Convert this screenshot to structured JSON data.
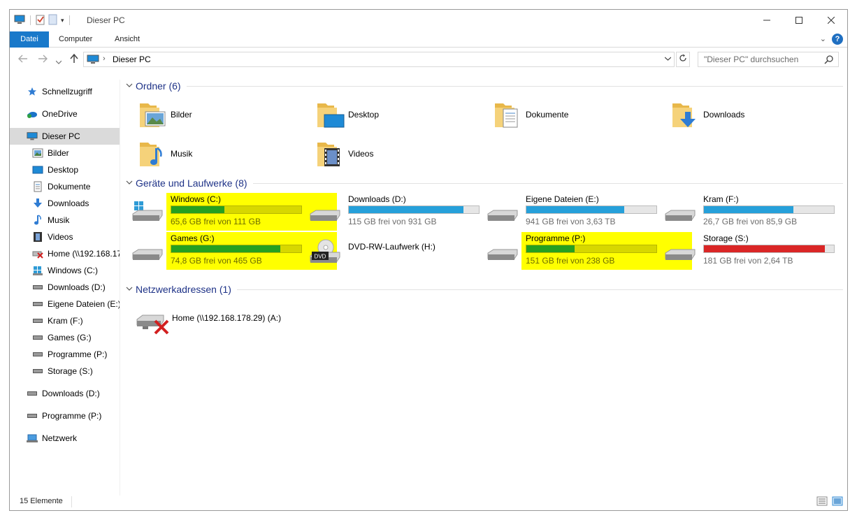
{
  "window": {
    "title": "Dieser PC"
  },
  "ribbon": {
    "tabs": [
      {
        "label": "Datei",
        "active": true
      },
      {
        "label": "Computer",
        "active": false
      },
      {
        "label": "Ansicht",
        "active": false
      }
    ],
    "help_label": "?"
  },
  "address": {
    "path": "Dieser PC",
    "search_placeholder": "\"Dieser PC\" durchsuchen"
  },
  "sidebar": {
    "items": [
      {
        "label": "Schnellzugriff",
        "icon": "star-icon"
      },
      {
        "label": "OneDrive",
        "icon": "onedrive-icon"
      },
      {
        "label": "Dieser PC",
        "icon": "computer-icon",
        "selected": true
      },
      {
        "label": "Bilder",
        "icon": "pictures-icon"
      },
      {
        "label": "Desktop",
        "icon": "desktop-icon"
      },
      {
        "label": "Dokumente",
        "icon": "documents-icon"
      },
      {
        "label": "Downloads",
        "icon": "download-icon"
      },
      {
        "label": "Musik",
        "icon": "music-icon"
      },
      {
        "label": "Videos",
        "icon": "video-icon"
      },
      {
        "label": "Home (\\\\192.168.17",
        "icon": "network-drive-disconnected-icon"
      },
      {
        "label": "Windows (C:)",
        "icon": "windows-drive-icon"
      },
      {
        "label": "Downloads (D:)",
        "icon": "drive-icon"
      },
      {
        "label": "Eigene Dateien (E:)",
        "icon": "drive-icon"
      },
      {
        "label": "Kram (F:)",
        "icon": "drive-icon"
      },
      {
        "label": "Games (G:)",
        "icon": "drive-icon"
      },
      {
        "label": "Programme (P:)",
        "icon": "drive-icon"
      },
      {
        "label": "Storage (S:)",
        "icon": "drive-icon"
      },
      {
        "label": "Downloads (D:)",
        "icon": "drive-icon"
      },
      {
        "label": "Programme (P:)",
        "icon": "drive-icon"
      },
      {
        "label": "Netzwerk",
        "icon": "network-icon"
      }
    ]
  },
  "groups": {
    "folders_title": "Ordner (6)",
    "drives_title": "Geräte und Laufwerke (8)",
    "network_title": "Netzwerkadressen (1)"
  },
  "folders": [
    {
      "label": "Bilder",
      "icon": "pictures-folder-icon"
    },
    {
      "label": "Desktop",
      "icon": "desktop-folder-icon"
    },
    {
      "label": "Dokumente",
      "icon": "documents-folder-icon"
    },
    {
      "label": "Downloads",
      "icon": "downloads-folder-icon"
    },
    {
      "label": "Musik",
      "icon": "music-folder-icon"
    },
    {
      "label": "Videos",
      "icon": "videos-folder-icon"
    }
  ],
  "drives": [
    {
      "name": "Windows (C:)",
      "free": "65,6 GB frei von 111 GB",
      "used_fraction": 0.41,
      "bar_color": "#26a020",
      "highlight": true
    },
    {
      "name": "Downloads (D:)",
      "free": "115 GB frei von 931 GB",
      "used_fraction": 0.88,
      "bar_color": "#26a0da",
      "highlight": false
    },
    {
      "name": "Eigene Dateien (E:)",
      "free": "941 GB frei von 3,63 TB",
      "used_fraction": 0.75,
      "bar_color": "#26a0da",
      "highlight": false
    },
    {
      "name": "Kram (F:)",
      "free": "26,7 GB frei von 85,9 GB",
      "used_fraction": 0.69,
      "bar_color": "#26a0da",
      "highlight": false
    },
    {
      "name": "Games (G:)",
      "free": "74,8 GB frei von 465 GB",
      "used_fraction": 0.84,
      "bar_color": "#26a020",
      "highlight": true
    },
    {
      "name": "DVD-RW-Laufwerk (H:)",
      "free": "",
      "used_fraction": null,
      "bar_color": "",
      "highlight": false
    },
    {
      "name": "Programme (P:)",
      "free": "151 GB frei von 238 GB",
      "used_fraction": 0.37,
      "bar_color": "#26a020",
      "highlight": true
    },
    {
      "name": "Storage (S:)",
      "free": "181 GB frei von 2,64 TB",
      "used_fraction": 0.93,
      "bar_color": "#da2626",
      "highlight": false
    }
  ],
  "dvd_icon_text": "DVD",
  "network_locations": [
    {
      "label": "Home (\\\\192.168.178.29) (A:)",
      "icon": "network-drive-disconnected-icon"
    }
  ],
  "status": {
    "item_count": "15 Elemente"
  },
  "colors": {
    "accent": "#1979ca",
    "highlight": "#ffff00",
    "group_title": "#1e3287"
  }
}
